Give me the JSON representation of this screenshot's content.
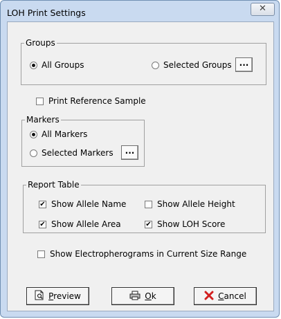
{
  "window": {
    "title": "LOH Print Settings",
    "close_glyph": "✕"
  },
  "groups": {
    "legend": "Groups",
    "all_label": "All Groups",
    "selected_label": "Selected Groups",
    "selection": "all",
    "browse_label": "..."
  },
  "print_reference": {
    "label": "Print Reference Sample",
    "checked": false
  },
  "markers": {
    "legend": "Markers",
    "all_label": "All Markers",
    "selected_label": "Selected Markers",
    "selection": "all",
    "browse_label": "..."
  },
  "report_table": {
    "legend": "Report Table",
    "options": [
      {
        "label": "Show Allele Name",
        "checked": true
      },
      {
        "label": "Show Allele Height",
        "checked": false
      },
      {
        "label": "Show Allele Area",
        "checked": true
      },
      {
        "label": "Show LOH Score",
        "checked": true
      }
    ]
  },
  "electropherograms": {
    "label": "Show Electropherograms in Current Size Range",
    "checked": false
  },
  "buttons": {
    "preview": {
      "mnemonic": "P",
      "rest": "review",
      "icon": "preview-icon"
    },
    "ok": {
      "mnemonic": "O",
      "rest": "k",
      "icon": "printer-icon"
    },
    "cancel": {
      "mnemonic": "C",
      "rest": "ancel",
      "icon": "cross-icon"
    }
  },
  "colors": {
    "cancel_icon": "#d21f1f",
    "window_frame": "#c9daf0",
    "client": "#f0f0f0"
  }
}
